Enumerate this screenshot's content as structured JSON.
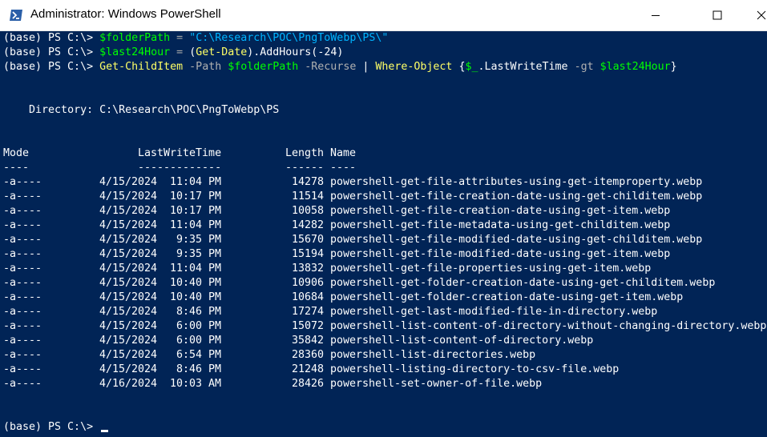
{
  "window": {
    "title": "Administrator: Windows PowerShell",
    "background": "#012456",
    "icons": {
      "app": "powershell-icon",
      "minimize": "minimize-icon",
      "maximize": "maximize-icon",
      "close": "close-icon"
    }
  },
  "commands": [
    {
      "prompt": "(base) PS C:\\> ",
      "parts": [
        {
          "text": "$folderPath",
          "kind": "var"
        },
        {
          "text": " = ",
          "kind": "op"
        },
        {
          "text": "\"C:\\Research\\POC\\PngToWebp\\PS\\\"",
          "kind": "str"
        }
      ]
    },
    {
      "prompt": "(base) PS C:\\> ",
      "parts": [
        {
          "text": "$last24Hour",
          "kind": "var"
        },
        {
          "text": " = ",
          "kind": "op"
        },
        {
          "text": "(",
          "kind": "def"
        },
        {
          "text": "Get-Date",
          "kind": "cmd"
        },
        {
          "text": ").AddHours(",
          "kind": "def"
        },
        {
          "text": "-24",
          "kind": "def"
        },
        {
          "text": ")",
          "kind": "def"
        }
      ]
    },
    {
      "prompt": "(base) PS C:\\> ",
      "parts": [
        {
          "text": "Get-ChildItem",
          "kind": "cmd"
        },
        {
          "text": " -Path ",
          "kind": "param"
        },
        {
          "text": "$folderPath",
          "kind": "var"
        },
        {
          "text": " -Recurse ",
          "kind": "param"
        },
        {
          "text": "| ",
          "kind": "def"
        },
        {
          "text": "Where-Object",
          "kind": "cmd"
        },
        {
          "text": " {",
          "kind": "def"
        },
        {
          "text": "$_",
          "kind": "var"
        },
        {
          "text": ".LastWriteTime ",
          "kind": "def"
        },
        {
          "text": "-gt ",
          "kind": "param"
        },
        {
          "text": "$last24Hour",
          "kind": "var"
        },
        {
          "text": "}",
          "kind": "def"
        }
      ]
    }
  ],
  "directory": {
    "label": "Directory:",
    "path": "C:\\Research\\POC\\PngToWebp\\PS"
  },
  "table": {
    "headers": [
      "Mode",
      "LastWriteTime",
      "Length",
      "Name"
    ],
    "underlines": [
      "----",
      "-------------",
      "------",
      "----"
    ],
    "rows": [
      {
        "mode": "-a----",
        "date": "4/15/2024",
        "time": "11:04 PM",
        "length": "14278",
        "name": "powershell-get-file-attributes-using-get-itemproperty.webp"
      },
      {
        "mode": "-a----",
        "date": "4/15/2024",
        "time": "10:17 PM",
        "length": "11514",
        "name": "powershell-get-file-creation-date-using-get-childitem.webp"
      },
      {
        "mode": "-a----",
        "date": "4/15/2024",
        "time": "10:17 PM",
        "length": "10058",
        "name": "powershell-get-file-creation-date-using-get-item.webp"
      },
      {
        "mode": "-a----",
        "date": "4/15/2024",
        "time": "11:04 PM",
        "length": "14282",
        "name": "powershell-get-file-metadata-using-get-childitem.webp"
      },
      {
        "mode": "-a----",
        "date": "4/15/2024",
        "time": "9:35 PM",
        "length": "15670",
        "name": "powershell-get-file-modified-date-using-get-childitem.webp"
      },
      {
        "mode": "-a----",
        "date": "4/15/2024",
        "time": "9:35 PM",
        "length": "15194",
        "name": "powershell-get-file-modified-date-using-get-item.webp"
      },
      {
        "mode": "-a----",
        "date": "4/15/2024",
        "time": "11:04 PM",
        "length": "13832",
        "name": "powershell-get-file-properties-using-get-item.webp"
      },
      {
        "mode": "-a----",
        "date": "4/15/2024",
        "time": "10:40 PM",
        "length": "10906",
        "name": "powershell-get-folder-creation-date-using-get-childitem.webp"
      },
      {
        "mode": "-a----",
        "date": "4/15/2024",
        "time": "10:40 PM",
        "length": "10684",
        "name": "powershell-get-folder-creation-date-using-get-item.webp"
      },
      {
        "mode": "-a----",
        "date": "4/15/2024",
        "time": "8:46 PM",
        "length": "17274",
        "name": "powershell-get-last-modified-file-in-directory.webp"
      },
      {
        "mode": "-a----",
        "date": "4/15/2024",
        "time": "6:00 PM",
        "length": "15072",
        "name": "powershell-list-content-of-directory-without-changing-directory.webp"
      },
      {
        "mode": "-a----",
        "date": "4/15/2024",
        "time": "6:00 PM",
        "length": "35842",
        "name": "powershell-list-content-of-directory.webp"
      },
      {
        "mode": "-a----",
        "date": "4/15/2024",
        "time": "6:54 PM",
        "length": "28360",
        "name": "powershell-list-directories.webp"
      },
      {
        "mode": "-a----",
        "date": "4/15/2024",
        "time": "8:46 PM",
        "length": "21248",
        "name": "powershell-listing-directory-to-csv-file.webp"
      },
      {
        "mode": "-a----",
        "date": "4/16/2024",
        "time": "10:03 AM",
        "length": "28426",
        "name": "powershell-set-owner-of-file.webp"
      }
    ]
  },
  "final_prompt": "(base) PS C:\\> "
}
